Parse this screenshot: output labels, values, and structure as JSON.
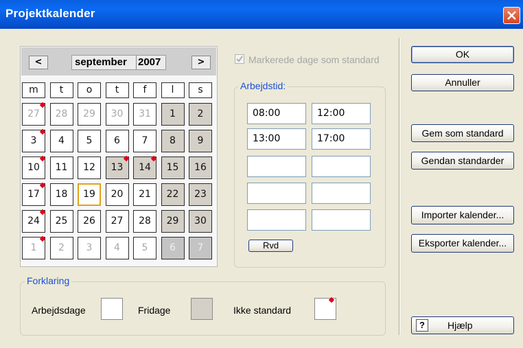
{
  "window": {
    "title": "Projektkalender"
  },
  "calendar": {
    "prev_label": "<",
    "next_label": ">",
    "month": "september",
    "year": "2007",
    "weekdays": [
      "m",
      "t",
      "o",
      "t",
      "f",
      "l",
      "s"
    ],
    "weeks": [
      [
        {
          "d": "27",
          "other": true,
          "flag": true
        },
        {
          "d": "28",
          "other": true
        },
        {
          "d": "29",
          "other": true
        },
        {
          "d": "30",
          "other": true
        },
        {
          "d": "31",
          "other": true
        },
        {
          "d": "1",
          "off": true
        },
        {
          "d": "2",
          "off": true
        }
      ],
      [
        {
          "d": "3",
          "flag": true
        },
        {
          "d": "4"
        },
        {
          "d": "5"
        },
        {
          "d": "6"
        },
        {
          "d": "7"
        },
        {
          "d": "8",
          "off": true
        },
        {
          "d": "9",
          "off": true
        }
      ],
      [
        {
          "d": "10",
          "flag": true
        },
        {
          "d": "11"
        },
        {
          "d": "12"
        },
        {
          "d": "13",
          "off": true,
          "flag": true
        },
        {
          "d": "14",
          "off": true,
          "flag": true
        },
        {
          "d": "15",
          "off": true
        },
        {
          "d": "16",
          "off": true
        }
      ],
      [
        {
          "d": "17",
          "flag": true
        },
        {
          "d": "18"
        },
        {
          "d": "19",
          "today": true
        },
        {
          "d": "20"
        },
        {
          "d": "21"
        },
        {
          "d": "22",
          "off": true
        },
        {
          "d": "23",
          "off": true
        }
      ],
      [
        {
          "d": "24",
          "flag": true
        },
        {
          "d": "25"
        },
        {
          "d": "26"
        },
        {
          "d": "27"
        },
        {
          "d": "28"
        },
        {
          "d": "29",
          "off": true
        },
        {
          "d": "30",
          "off": true
        }
      ],
      [
        {
          "d": "1",
          "other": true,
          "flag": true
        },
        {
          "d": "2",
          "other": true
        },
        {
          "d": "3",
          "other": true
        },
        {
          "d": "4",
          "other": true
        },
        {
          "d": "5",
          "other": true
        },
        {
          "d": "6",
          "other": true,
          "off": true
        },
        {
          "d": "7",
          "other": true,
          "off": true
        }
      ]
    ],
    "monday_header_flag": true
  },
  "options": {
    "mark_as_standard_label": "Markerede dage som standard",
    "mark_as_standard_checked": true,
    "mark_as_standard_enabled": false
  },
  "worktime": {
    "title": "Arbejdstid:",
    "rows": [
      {
        "from": "08:00",
        "to": "12:00"
      },
      {
        "from": "13:00",
        "to": "17:00"
      },
      {
        "from": "",
        "to": ""
      },
      {
        "from": "",
        "to": ""
      },
      {
        "from": "",
        "to": ""
      }
    ],
    "clear_label": "Rvd"
  },
  "legend": {
    "title": "Forklaring",
    "workdays_label": "Arbejdsdage",
    "holidays_label": "Fridage",
    "nonstandard_label": "Ikke standard"
  },
  "buttons": {
    "ok": "OK",
    "cancel": "Annuller",
    "save_default": "Gem som standard",
    "restore_defaults": "Gendan standarder",
    "import": "Importer kalender...",
    "export": "Eksporter kalender...",
    "help": "Hjælp"
  },
  "colors": {
    "title_bar": "#0b6af2",
    "close_button": "#d2471f",
    "nonworking_day": "#d4d0c8",
    "nonstandard_marker": "#e0001a",
    "today_border": "#e0a21a",
    "group_title": "#1c4fd6"
  }
}
